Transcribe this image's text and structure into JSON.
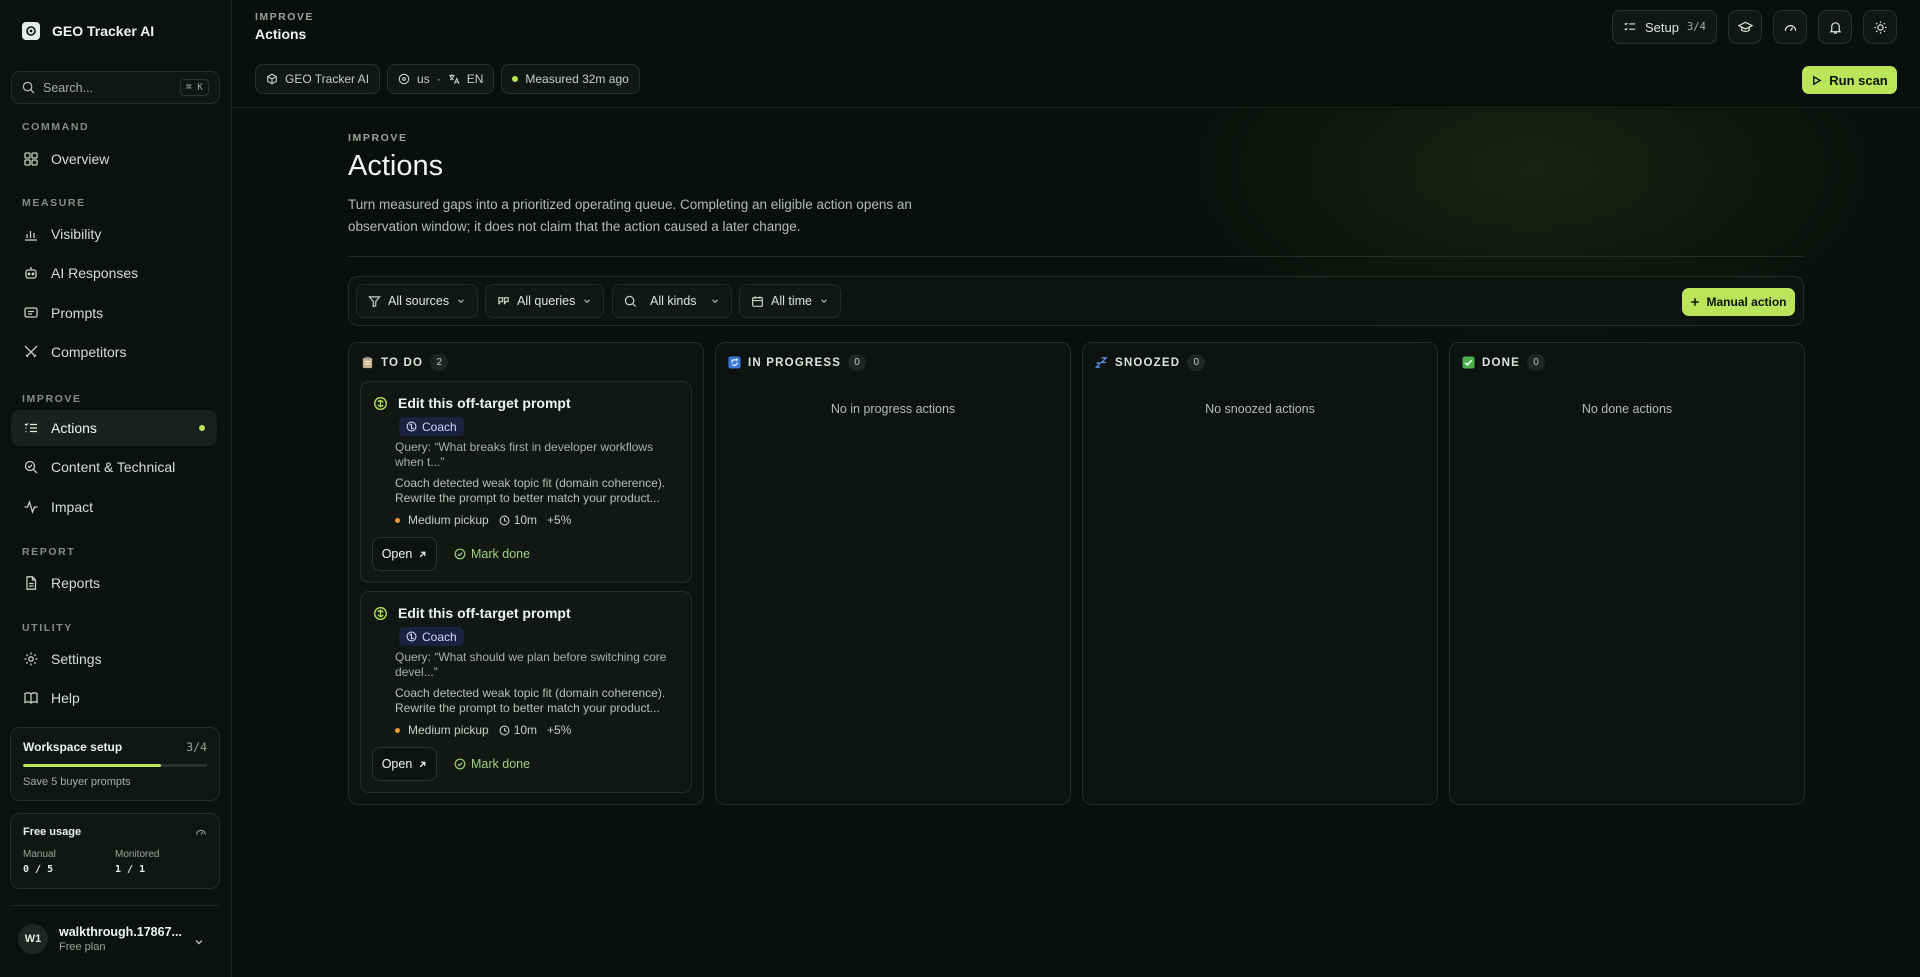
{
  "app": {
    "name": "GEO Tracker AI"
  },
  "search": {
    "placeholder": "Search...",
    "shortcut": "⌘ K"
  },
  "sidebar": {
    "sections": [
      {
        "label": "COMMAND"
      },
      {
        "label": "MEASURE"
      },
      {
        "label": "IMPROVE"
      },
      {
        "label": "REPORT"
      },
      {
        "label": "UTILITY"
      }
    ],
    "items": [
      {
        "label": "Overview",
        "icon": "grid-icon"
      },
      {
        "label": "Visibility",
        "icon": "bar-chart-icon"
      },
      {
        "label": "AI Responses",
        "icon": "bot-icon"
      },
      {
        "label": "Prompts",
        "icon": "message-icon"
      },
      {
        "label": "Competitors",
        "icon": "swords-icon"
      },
      {
        "label": "Actions",
        "icon": "list-todo-icon",
        "active": true
      },
      {
        "label": "Content & Technical",
        "icon": "search-check-icon"
      },
      {
        "label": "Impact",
        "icon": "activity-icon"
      },
      {
        "label": "Reports",
        "icon": "file-icon"
      },
      {
        "label": "Settings",
        "icon": "gear-icon"
      },
      {
        "label": "Help",
        "icon": "book-icon"
      }
    ]
  },
  "workspace_setup": {
    "title": "Workspace setup",
    "count": "3/4",
    "progress": 0.75,
    "subtitle": "Save 5 buyer prompts"
  },
  "usage": {
    "title": "Free usage",
    "manual_label": "Manual",
    "manual_value": "0 / 5",
    "monitored_label": "Monitored",
    "monitored_value": "1 / 1"
  },
  "user": {
    "initials": "W1",
    "name": "walkthrough.17867...",
    "plan": "Free plan"
  },
  "header": {
    "eyebrow": "IMPROVE",
    "title": "Actions",
    "chips": {
      "project": "GEO Tracker AI",
      "region": "us",
      "language": "EN",
      "measured": "Measured 32m ago"
    },
    "setup_label": "Setup",
    "setup_count": "3/4",
    "run_scan": "Run scan"
  },
  "page": {
    "eyebrow": "IMPROVE",
    "title": "Actions",
    "description": "Turn measured gaps into a prioritized operating queue. Completing an eligible action opens an observation window; it does not claim that the action caused a later change."
  },
  "filters": {
    "sources": "All sources",
    "queries": "All queries",
    "kinds": "All kinds",
    "time": "All time",
    "manual_action": "Manual action"
  },
  "columns": [
    {
      "title": "TO DO",
      "count": "2",
      "emoji": "📋",
      "empty": ""
    },
    {
      "title": "IN PROGRESS",
      "count": "0",
      "emoji": "🔄",
      "empty": "No in progress actions"
    },
    {
      "title": "SNOOZED",
      "count": "0",
      "emoji": "💤",
      "empty": "No snoozed actions"
    },
    {
      "title": "DONE",
      "count": "0",
      "emoji": "✅",
      "empty": "No done actions"
    }
  ],
  "cards": [
    {
      "title": "Edit this off-target prompt",
      "badge": "Coach",
      "query": "Query: “What breaks first in developer workflows when t...”",
      "body": "Coach detected weak topic fit (domain coherence). Rewrite the prompt to better match your product...",
      "pickup": "Medium pickup",
      "time": "10m",
      "lift": "+5%",
      "open": "Open",
      "mark_done": "Mark done"
    },
    {
      "title": "Edit this off-target prompt",
      "badge": "Coach",
      "query": "Query: “What should we plan before switching core devel...”",
      "body": "Coach detected weak topic fit (domain coherence). Rewrite the prompt to better match your product...",
      "pickup": "Medium pickup",
      "time": "10m",
      "lift": "+5%",
      "open": "Open",
      "mark_done": "Mark done"
    }
  ],
  "colors": {
    "accent": "#b8e55a",
    "background": "#0b0f0c",
    "pickup": "#f09a2e",
    "badge": "#1b2240"
  }
}
